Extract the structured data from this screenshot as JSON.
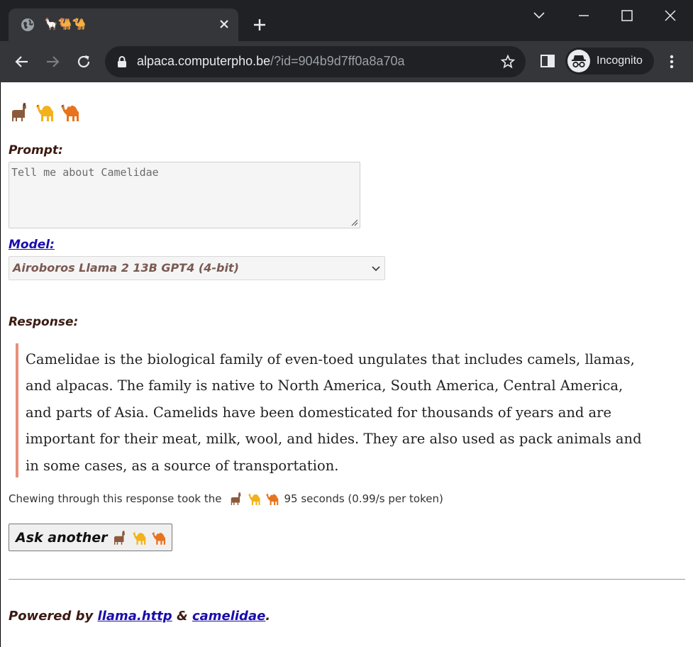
{
  "browser": {
    "tab_title": "🦙🐫🐪",
    "url_host": "alpaca.computerpho.be",
    "url_path": "/?id=904b9d7ff0a8a70a",
    "incognito_label": "Incognito"
  },
  "page": {
    "emoji_title": "🦙🐫🐪",
    "prompt_label": "Prompt:",
    "prompt_value": "Tell me about Camelidae",
    "model_label": "Model:",
    "model_selected": "Airoboros Llama 2 13B GPT4 (4-bit)",
    "response_label": "Response:",
    "response_text": "Camelidae is the biological family of even-toed ungulates that includes camels, llamas, and alpacas. The family is native to North America, South America, Central America, and parts of Asia. Camelids have been domesticated for thousands of years and are important for their meat, milk, wool, and hides. They are also used as pack animals and in some cases, as a source of transportation.",
    "timing_prefix": "Chewing through this response took the",
    "timing_suffix": "95 seconds (0.99/s per token)",
    "ask_button_label": "Ask another",
    "footer_prefix": "Powered by",
    "footer_link1": "llama.http",
    "footer_amp": "&",
    "footer_link2": "camelidae",
    "footer_end": "."
  },
  "colors": {
    "accent_border": "#e8907a",
    "label_text": "#3b1a12",
    "link": "#1a0dab"
  }
}
